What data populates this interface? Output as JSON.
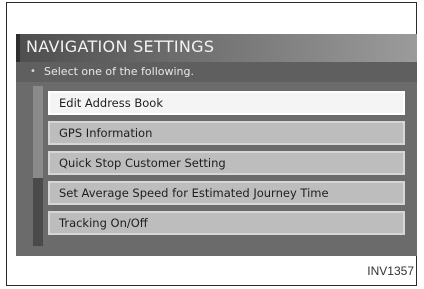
{
  "title": "NAVIGATION SETTINGS",
  "subtitle": "Select one of the following.",
  "bullet": "•",
  "menu": {
    "items": [
      {
        "label": "Edit Address Book",
        "selected": true
      },
      {
        "label": "GPS Information",
        "selected": false
      },
      {
        "label": "Quick Stop Customer Setting",
        "selected": false
      },
      {
        "label": "Set Average Speed for Estimated Journey Time",
        "selected": false
      },
      {
        "label": "Tracking On/Off",
        "selected": false
      }
    ]
  },
  "figure_code": "INV1357",
  "colors": {
    "screen_bg": "#6b6b6b",
    "selected_item_bg": "#f4f4f4",
    "item_bg": "#bdbdbd",
    "title_text": "#f2f2f2"
  }
}
